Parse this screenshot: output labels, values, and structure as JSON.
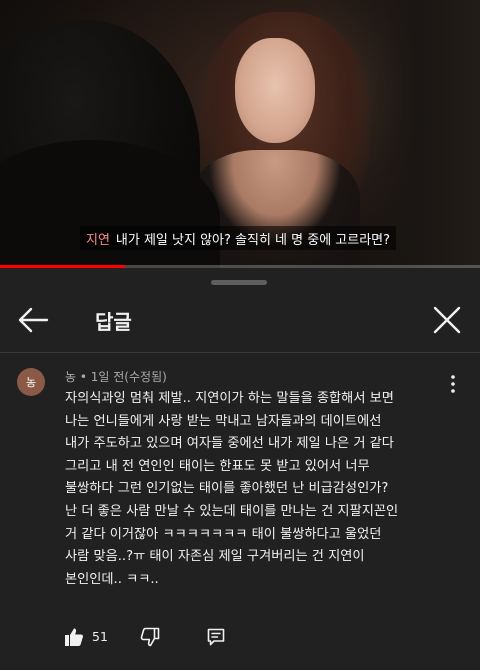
{
  "video": {
    "subtitle_speaker": "지연",
    "subtitle_text": "내가 제일 낫지 않아? 솔직히 네 명 중에 고르라면?",
    "progress": 0.26,
    "progress_color": "#ff0000"
  },
  "header": {
    "title": "답글",
    "back_icon": "arrow-left-icon",
    "close_icon": "close-icon"
  },
  "comment": {
    "avatar_text": "농",
    "author": "농",
    "separator": "•",
    "time": "1일 전(수정됨)",
    "lines": [
      "자의식과잉 멈춰 제발.. 지연이가 하는 말들을 종합해서 보면",
      "나는 언니들에게 사랑 받는 막내고 남자들과의 데이트에선",
      "내가 주도하고 있으며 여자들 중에선 내가 제일 나은 거 같다",
      "그리고 내 전 연인인 태이는 한표도 못 받고 있어서 너무",
      "불쌍하다 그런 인기없는 태이를 좋아했던 난 비급감성인가?",
      "난 더 좋은 사람 만날 수 있는데 태이를 만나는 건 지팔지꼰인",
      "거 같다 이거잖아 ㅋㅋㅋㅋㅋㅋㅋ 태이 불쌍하다고 울었던",
      "사람 맞음..?ㅠ 태이 자존심 제일 구겨버리는 건 지연이",
      "본인인데.. ㅋㅋ.."
    ],
    "like_count": "51"
  },
  "colors": {
    "background": "#212121",
    "text": "#f1f1f1",
    "secondary_text": "#aaaaaa",
    "avatar": "#8a5a46"
  }
}
